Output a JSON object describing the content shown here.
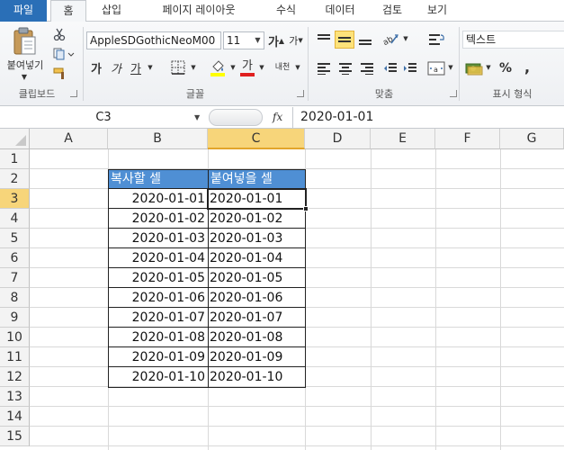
{
  "tabs": {
    "file": "파일",
    "home": "홈",
    "insert": "삽입",
    "page_layout": "페이지 레이아웃",
    "formulas": "수식",
    "data": "데이터",
    "review": "검토",
    "view": "보기"
  },
  "ribbon": {
    "clipboard": {
      "label": "클립보드",
      "paste_label": "붙여넣기"
    },
    "font": {
      "label": "글꼴",
      "font_name": "AppleSDGothicNeoM00",
      "font_size": "11",
      "grow": "가",
      "shrink": "가",
      "bold": "가",
      "italic": "가",
      "underline": "가",
      "font_color": "가",
      "phonetic": "내천"
    },
    "alignment": {
      "label": "맞춤"
    },
    "number": {
      "label": "표시 형식",
      "format": "텍스트",
      "percent": "%",
      "comma": ","
    }
  },
  "formula_bar": {
    "name_box": "C3",
    "fx": "fx",
    "value": "2020-01-01"
  },
  "sheet": {
    "columns": [
      "A",
      "B",
      "C",
      "D",
      "E",
      "F",
      "G"
    ],
    "rows": [
      "1",
      "2",
      "3",
      "4",
      "5",
      "6",
      "7",
      "8",
      "9",
      "10",
      "11",
      "12",
      "13",
      "14",
      "15"
    ],
    "active_cell": "C3",
    "header_fill": "#4f8fd4",
    "table": {
      "header": [
        "복사할 셀",
        "붙여넣을 셀"
      ],
      "rows": [
        [
          "2020-01-01",
          "2020-01-01"
        ],
        [
          "2020-01-02",
          "2020-01-02"
        ],
        [
          "2020-01-03",
          "2020-01-03"
        ],
        [
          "2020-01-04",
          "2020-01-04"
        ],
        [
          "2020-01-05",
          "2020-01-05"
        ],
        [
          "2020-01-06",
          "2020-01-06"
        ],
        [
          "2020-01-07",
          "2020-01-07"
        ],
        [
          "2020-01-08",
          "2020-01-08"
        ],
        [
          "2020-01-09",
          "2020-01-09"
        ],
        [
          "2020-01-10",
          "2020-01-10"
        ]
      ]
    }
  }
}
